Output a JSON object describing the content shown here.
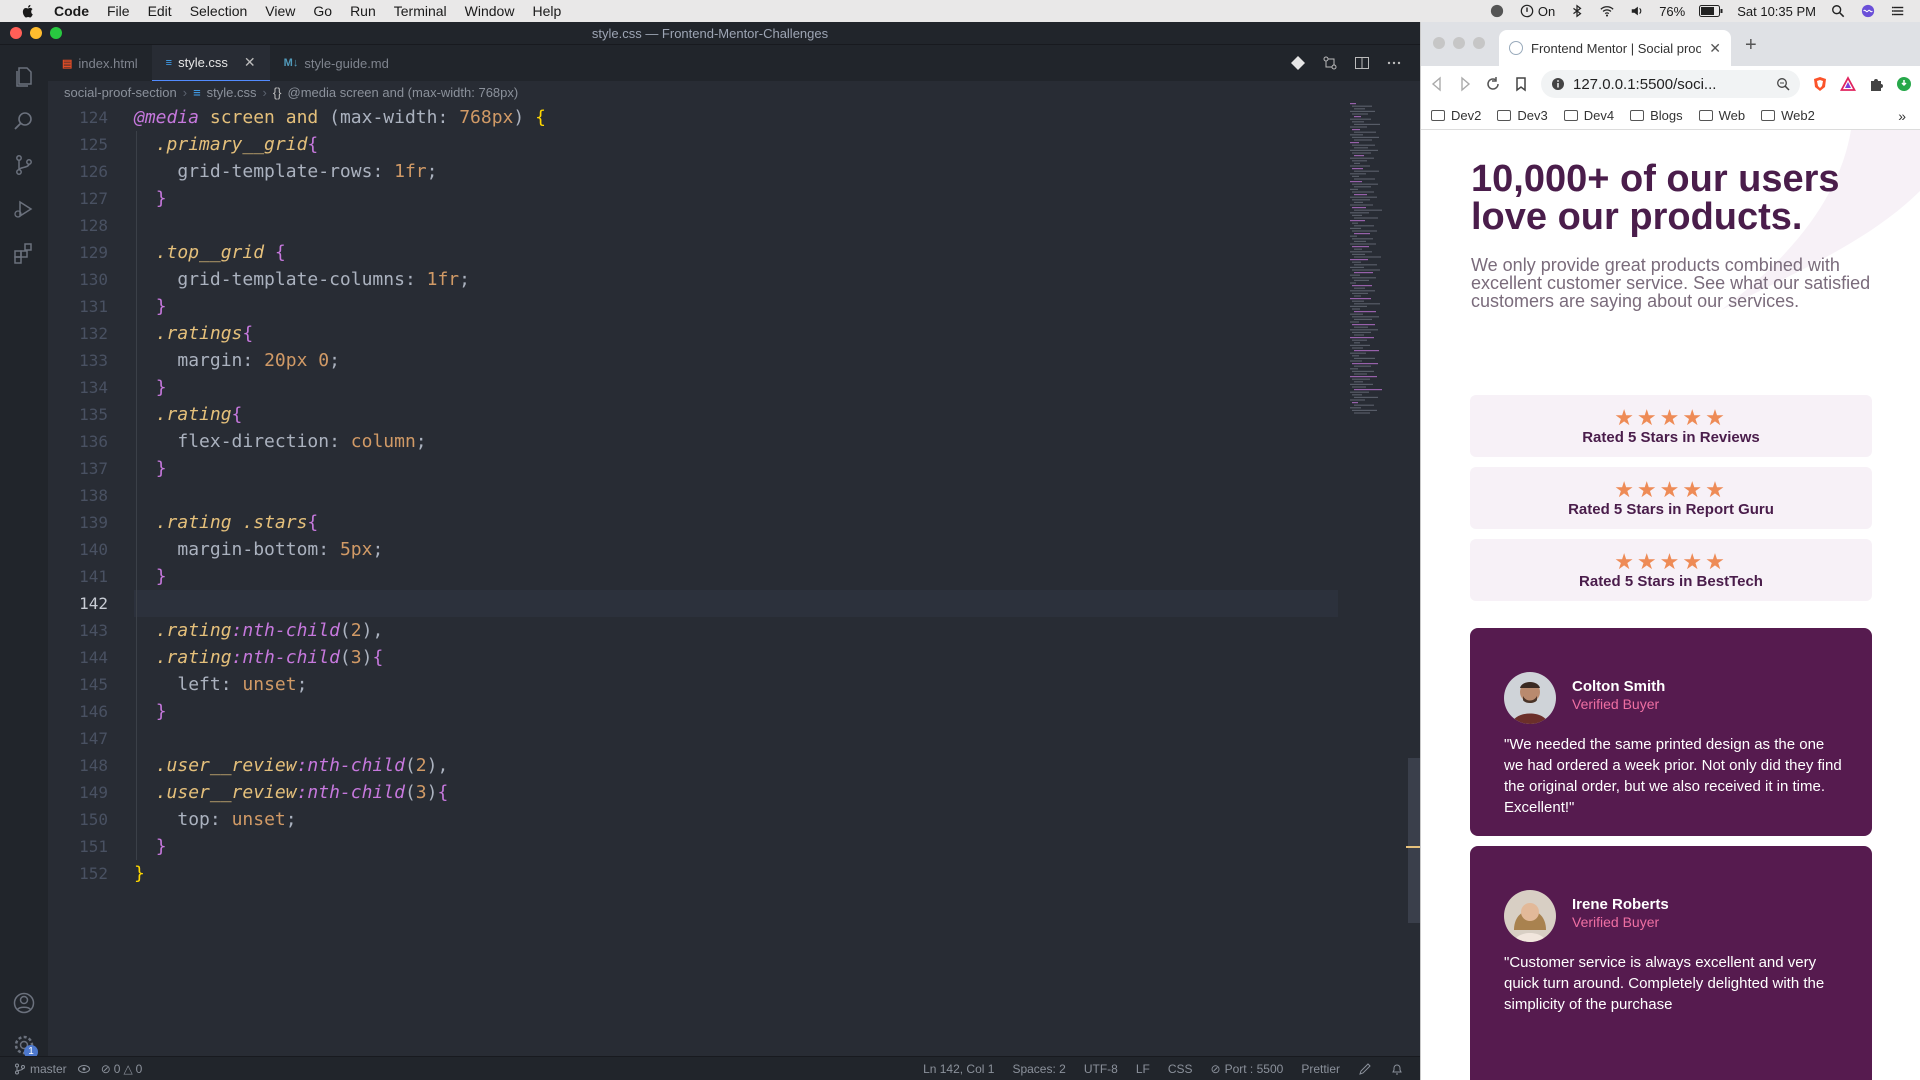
{
  "menubar": {
    "app": "Code",
    "items": [
      "File",
      "Edit",
      "Selection",
      "View",
      "Go",
      "Run",
      "Terminal",
      "Window",
      "Help"
    ],
    "status_on": "On",
    "battery": "76%",
    "clock": "Sat 10:35 PM"
  },
  "vscode": {
    "window_title": "style.css — Frontend-Mentor-Challenges",
    "tabs": [
      {
        "label": "index.html",
        "icon": "html-file-icon"
      },
      {
        "label": "style.css",
        "icon": "css-file-icon"
      },
      {
        "label": "style-guide.md",
        "icon": "markdown-file-icon"
      }
    ],
    "breadcrumb": [
      "social-proof-section",
      "style.css",
      "@media screen and (max-width: 768px)"
    ],
    "first_line": 124,
    "statusbar": {
      "branch": "master",
      "errors": "0",
      "warnings": "0",
      "cursor": "Ln 142, Col 1",
      "spaces": "Spaces: 2",
      "encoding": "UTF-8",
      "eol": "LF",
      "language": "CSS",
      "port": "Port : 5500",
      "formatter": "Prettier",
      "settings_badge": "1"
    }
  },
  "code_lines": [
    {
      "t": "@media screen and (max-width: 768px) {"
    },
    {
      "t": "  .primary__grid{"
    },
    {
      "t": "    grid-template-rows: 1fr;"
    },
    {
      "t": "  }"
    },
    {
      "t": ""
    },
    {
      "t": "  .top__grid {"
    },
    {
      "t": "    grid-template-columns: 1fr;"
    },
    {
      "t": "  }"
    },
    {
      "t": "  .ratings{"
    },
    {
      "t": "    margin: 20px 0;"
    },
    {
      "t": "  }"
    },
    {
      "t": "  .rating{"
    },
    {
      "t": "    flex-direction: column;"
    },
    {
      "t": "  }"
    },
    {
      "t": ""
    },
    {
      "t": "  .rating .stars{"
    },
    {
      "t": "    margin-bottom: 5px;"
    },
    {
      "t": "  }"
    },
    {
      "t": ""
    },
    {
      "t": "  .rating:nth-child(2),"
    },
    {
      "t": "  .rating:nth-child(3){"
    },
    {
      "t": "    left: unset;"
    },
    {
      "t": "  }"
    },
    {
      "t": ""
    },
    {
      "t": "  .user__review:nth-child(2),"
    },
    {
      "t": "  .user__review:nth-child(3){"
    },
    {
      "t": "    top: unset;"
    },
    {
      "t": "  }"
    },
    {
      "t": "}"
    }
  ],
  "browser": {
    "tab_title": "Frontend Mentor | Social proof s",
    "url": "127.0.0.1:5500/soci...",
    "bookmarks": [
      "Dev2",
      "Dev3",
      "Dev4",
      "Blogs",
      "Web",
      "Web2"
    ]
  },
  "site": {
    "title": "10,000+ of our users love our products.",
    "intro": "We only provide great products combined with excellent customer service. See what our satisfied customers are saying about our services.",
    "stars": "★★★★★",
    "ratings": [
      "Rated 5 Stars in Reviews",
      "Rated 5 Stars in Report Guru",
      "Rated 5 Stars in BestTech"
    ],
    "reviews": [
      {
        "name": "Colton Smith",
        "badge": "Verified Buyer",
        "quote": "\"We needed the same printed design as the one we had ordered a week prior. Not only did they find the original order, but we also received it in time. Excellent!\""
      },
      {
        "name": "Irene Roberts",
        "badge": "Verified Buyer",
        "quote": "\"Customer service is always excellent and very quick turn around. Completely delighted with the simplicity of the purchase"
      }
    ]
  },
  "colors": {
    "site_primary": "#561b4f",
    "site_accent": "#ee8b56",
    "site_pink": "#ef6fa3",
    "editor_bg": "#282c34"
  }
}
